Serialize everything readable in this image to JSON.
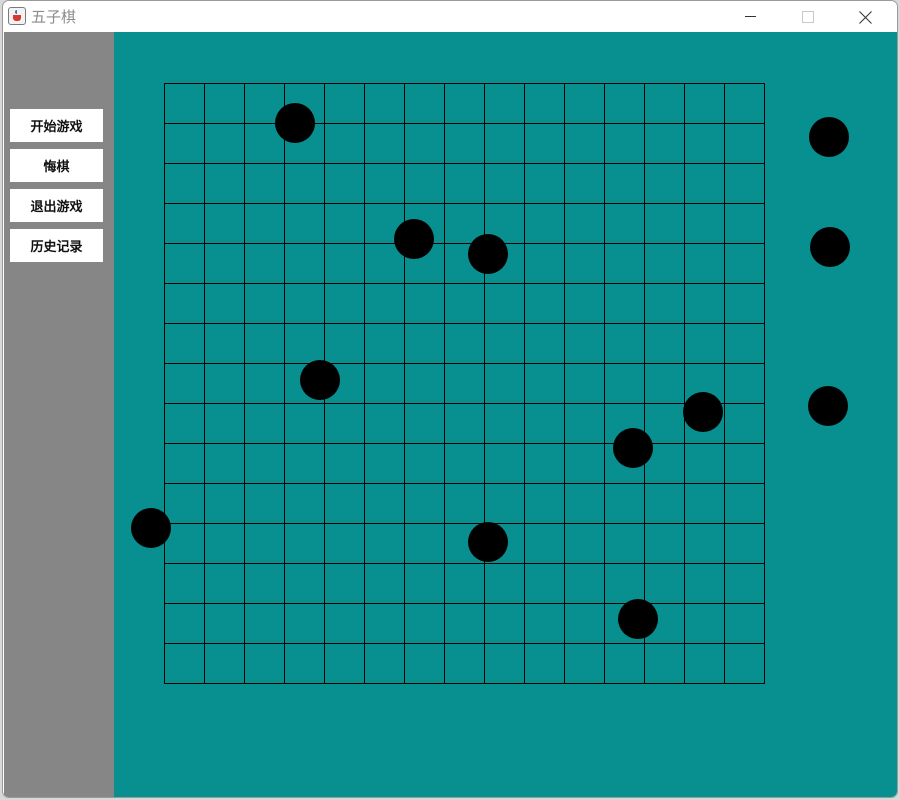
{
  "window": {
    "title": "五子棋",
    "controls": [
      "minimize",
      "maximize",
      "close"
    ]
  },
  "icons": {
    "app": "java-cup-icon",
    "minimize": "minimize-icon",
    "maximize": "maximize-icon",
    "close": "close-icon"
  },
  "sidebar": {
    "buttons": [
      {
        "label": "开始游戏"
      },
      {
        "label": "悔棋"
      },
      {
        "label": "退出游戏"
      },
      {
        "label": "历史记录"
      }
    ]
  },
  "board": {
    "columns": 15,
    "rows": 15,
    "stones": [
      {
        "color": "black",
        "col": 3,
        "row": 1
      },
      {
        "color": "black",
        "col": 6,
        "row": 4
      },
      {
        "color": "black",
        "col": 8,
        "row": 4
      },
      {
        "color": "black",
        "col": 3,
        "row": 7
      },
      {
        "color": "black",
        "col": 13,
        "row": 8
      },
      {
        "color": "black",
        "col": 11,
        "row": 9
      },
      {
        "color": "black",
        "col": 0,
        "row": 11
      },
      {
        "color": "black",
        "col": 8,
        "row": 11
      },
      {
        "color": "black",
        "col": 11,
        "row": 13
      },
      {
        "color": "black",
        "col": 16,
        "row": 1
      },
      {
        "color": "black",
        "col": 16,
        "row": 4
      },
      {
        "color": "black",
        "col": 16,
        "row": 8
      }
    ]
  },
  "colors": {
    "board": "#088f8f",
    "sidebar": "#868686",
    "grid_line": "#000000",
    "stone_black": "#000000"
  }
}
